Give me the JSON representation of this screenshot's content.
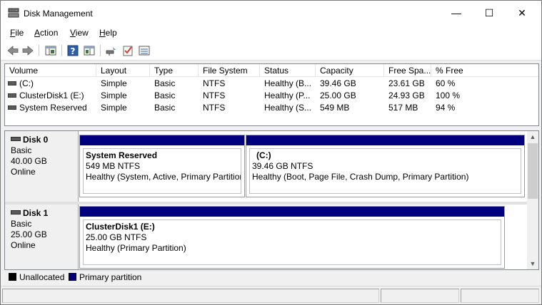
{
  "window": {
    "title": "Disk Management",
    "minimize_glyph": "—",
    "maximize_glyph": "☐",
    "close_glyph": "✕"
  },
  "menu": {
    "items": [
      "File",
      "Action",
      "View",
      "Help"
    ],
    "accelerators": [
      "F",
      "A",
      "V",
      "H"
    ]
  },
  "toolbar": {
    "buttons": [
      "back-icon",
      "forward-icon",
      "console-tree-icon",
      "help-icon",
      "details-pane-icon",
      "connect-icon",
      "checkmark-properties-icon",
      "list-view-icon"
    ]
  },
  "volume_list": {
    "columns": [
      "Volume",
      "Layout",
      "Type",
      "File System",
      "Status",
      "Capacity",
      "Free Spa...",
      "% Free"
    ],
    "rows": [
      {
        "volume": "(C:)",
        "layout": "Simple",
        "type": "Basic",
        "fs": "NTFS",
        "status": "Healthy (B...",
        "capacity": "39.46 GB",
        "free": "23.61 GB",
        "pct": "60 %"
      },
      {
        "volume": "ClusterDisk1 (E:)",
        "layout": "Simple",
        "type": "Basic",
        "fs": "NTFS",
        "status": "Healthy (P...",
        "capacity": "25.00 GB",
        "free": "24.93 GB",
        "pct": "100 %"
      },
      {
        "volume": "System Reserved",
        "layout": "Simple",
        "type": "Basic",
        "fs": "NTFS",
        "status": "Healthy (S...",
        "capacity": "549 MB",
        "free": "517 MB",
        "pct": "94 %"
      }
    ]
  },
  "disks": [
    {
      "name": "Disk 0",
      "type": "Basic",
      "size": "40.00 GB",
      "state": "Online",
      "partitions": [
        {
          "name": "System Reserved",
          "size_fs": "549 MB NTFS",
          "status": "Healthy (System, Active, Primary Partition)"
        },
        {
          "name": "(C:)",
          "size_fs": "39.46 GB NTFS",
          "status": "Healthy (Boot, Page File, Crash Dump, Primary Partition)"
        }
      ]
    },
    {
      "name": "Disk 1",
      "type": "Basic",
      "size": "25.00 GB",
      "state": "Online",
      "partitions": [
        {
          "name": "ClusterDisk1  (E:)",
          "size_fs": "25.00 GB NTFS",
          "status": "Healthy (Primary Partition)"
        }
      ]
    }
  ],
  "legend": {
    "unallocated": "Unallocated",
    "primary": "Primary partition",
    "unallocated_color": "#000000",
    "primary_color": "#00007f"
  },
  "scrollbar": {
    "up_glyph": "▲",
    "down_glyph": "▼"
  }
}
